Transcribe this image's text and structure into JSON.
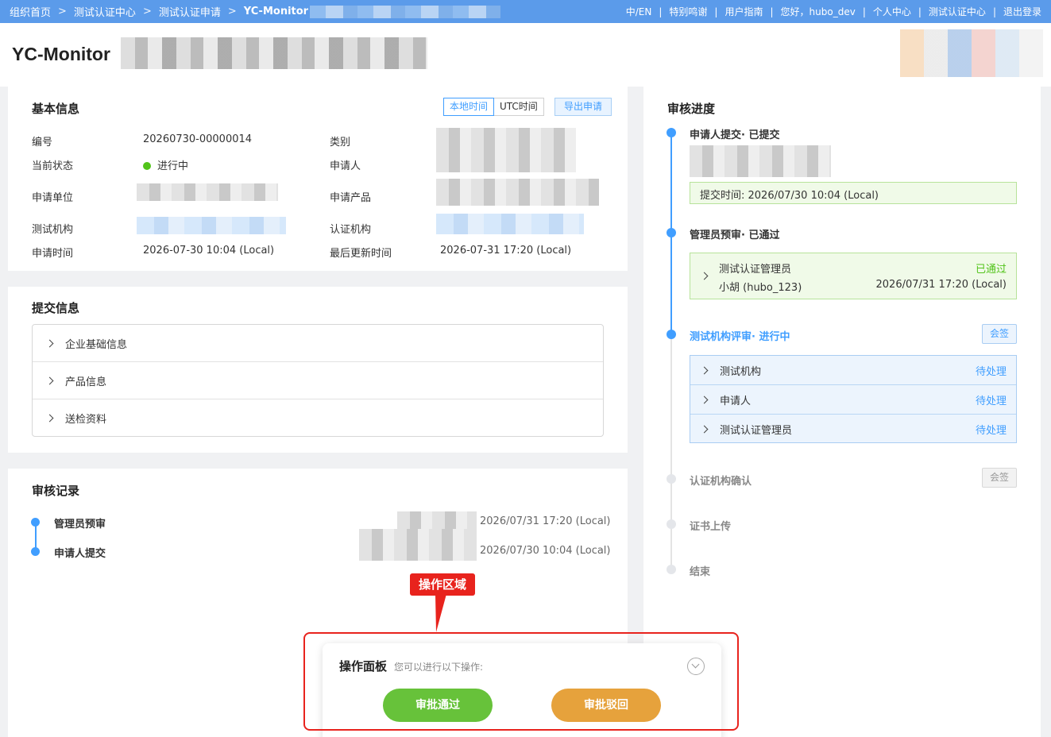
{
  "topbar": {
    "breadcrumbs": [
      "组织首页",
      "测试认证中心",
      "测试认证申请",
      "YC-Monitor"
    ],
    "links": [
      "中/EN",
      "特别鸣谢",
      "用户指南",
      "您好，hubo_dev",
      "个人中心",
      "测试认证中心",
      "退出登录"
    ]
  },
  "header": {
    "title": "YC-Monitor"
  },
  "basic_info": {
    "title": "基本信息",
    "local_time_label": "本地时间",
    "utc_time_label": "UTC时间",
    "export_label": "导出申请",
    "fields": {
      "id_label": "编号",
      "id_value": "20260730-00000014",
      "category_label": "类别",
      "status_label": "当前状态",
      "status_value": "进行中",
      "applicant_label": "申请人",
      "unit_label": "申请单位",
      "product_label": "申请产品",
      "test_org_label": "测试机构",
      "cert_org_label": "认证机构",
      "apply_time_label": "申请时间",
      "apply_time_value": "2026-07-30 10:04 (Local)",
      "updated_label": "最后更新时间",
      "updated_value": "2026-07-31 17:20 (Local)"
    }
  },
  "submission": {
    "title": "提交信息",
    "items": [
      "企业基础信息",
      "产品信息",
      "送检资料"
    ]
  },
  "records": {
    "title": "审核记录",
    "items": [
      {
        "label": "管理员预审",
        "time": "2026/07/31 17:20 (Local)"
      },
      {
        "label": "申请人提交",
        "time": "2026/07/30 10:04 (Local)"
      }
    ]
  },
  "progress": {
    "title": "审核进度",
    "step1": {
      "label": "申请人提交· 已提交",
      "submit_time": "提交时间:   2026/07/30 10:04 (Local)"
    },
    "step2": {
      "label": "管理员预审· 已通过",
      "reviewer": "测试认证管理员",
      "status": "已通过",
      "user": "小胡 (hubo_123)",
      "time": "2026/07/31 17:20 (Local)"
    },
    "step3": {
      "label": "测试机构评审· 进行中",
      "tag": "会签",
      "rows": [
        {
          "name": "测试机构",
          "status": "待处理"
        },
        {
          "name": "申请人",
          "status": "待处理"
        },
        {
          "name": "测试认证管理员",
          "status": "待处理"
        }
      ]
    },
    "step4": {
      "label": "认证机构确认",
      "tag": "会签"
    },
    "step5": {
      "label": "证书上传"
    },
    "step6": {
      "label": "结束"
    }
  },
  "operation": {
    "callout": "操作区域",
    "title": "操作面板",
    "subtitle": "您可以进行以下操作:",
    "approve_label": "审批通过",
    "reject_label": "审批驳回"
  }
}
